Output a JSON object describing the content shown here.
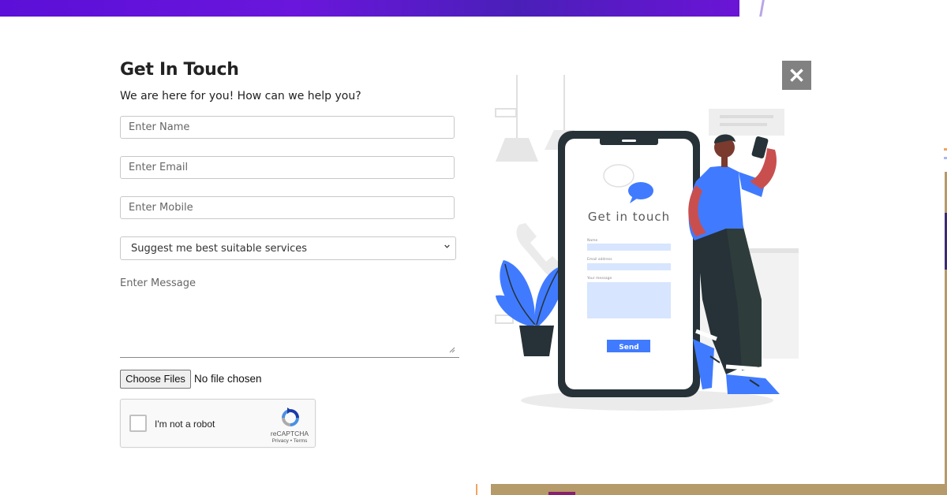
{
  "form": {
    "title": "Get In Touch",
    "subtitle": "We are here for you! How can we help you?",
    "name_placeholder": "Enter Name",
    "email_placeholder": "Enter Email",
    "mobile_placeholder": "Enter Mobile",
    "service_selected": "Suggest me best suitable services",
    "message_placeholder": "Enter Message",
    "file_button": "Choose Files",
    "file_status": "No file chosen"
  },
  "captcha": {
    "label": "I'm not a robot",
    "brand": "reCAPTCHA",
    "links": "Privacy • Terms"
  },
  "close": {
    "symbol": "✕",
    "icon": "close-icon"
  },
  "illustration": {
    "heading": "Get in touch",
    "field_name": "Name",
    "field_email": "Email address",
    "field_message": "Your message",
    "send_label": "Send"
  },
  "colors": {
    "accent_blue": "#407bff",
    "phone_dark": "#263238",
    "banner_purple": "#5b0fd8"
  }
}
